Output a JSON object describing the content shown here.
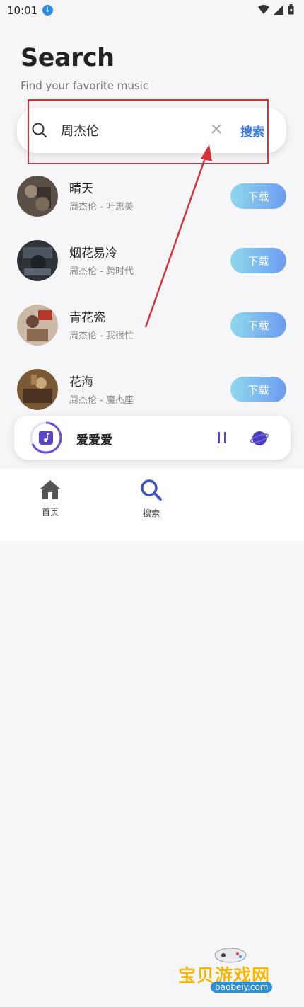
{
  "status_bar": {
    "time": "10:01"
  },
  "header": {
    "title": "Search",
    "subtitle": "Find your favorite music"
  },
  "search": {
    "value": "周杰伦",
    "button_label": "搜索"
  },
  "songs": [
    {
      "title": "晴天",
      "subtitle": "周杰伦 - 叶惠美",
      "download_label": "下载"
    },
    {
      "title": "烟花易冷",
      "subtitle": "周杰伦 - 跨时代",
      "download_label": "下载"
    },
    {
      "title": "青花瓷",
      "subtitle": "周杰伦 - 我很忙",
      "download_label": "下载"
    },
    {
      "title": "花海",
      "subtitle": "周杰伦 - 魔杰座",
      "download_label": "下载"
    }
  ],
  "player": {
    "title": "爱爱爱"
  },
  "tabs": [
    {
      "label": "首页",
      "icon": "home-icon"
    },
    {
      "label": "搜索",
      "icon": "search-icon"
    }
  ],
  "watermark": {
    "text": "宝贝游戏网",
    "url": "baobeiy.com"
  },
  "colors": {
    "accent": "#3a7ee0",
    "download_gradient_start": "#8fd8ee",
    "download_gradient_end": "#6c9cf0",
    "annotation": "#d6323a",
    "player_ring": "#6b4fd8"
  }
}
